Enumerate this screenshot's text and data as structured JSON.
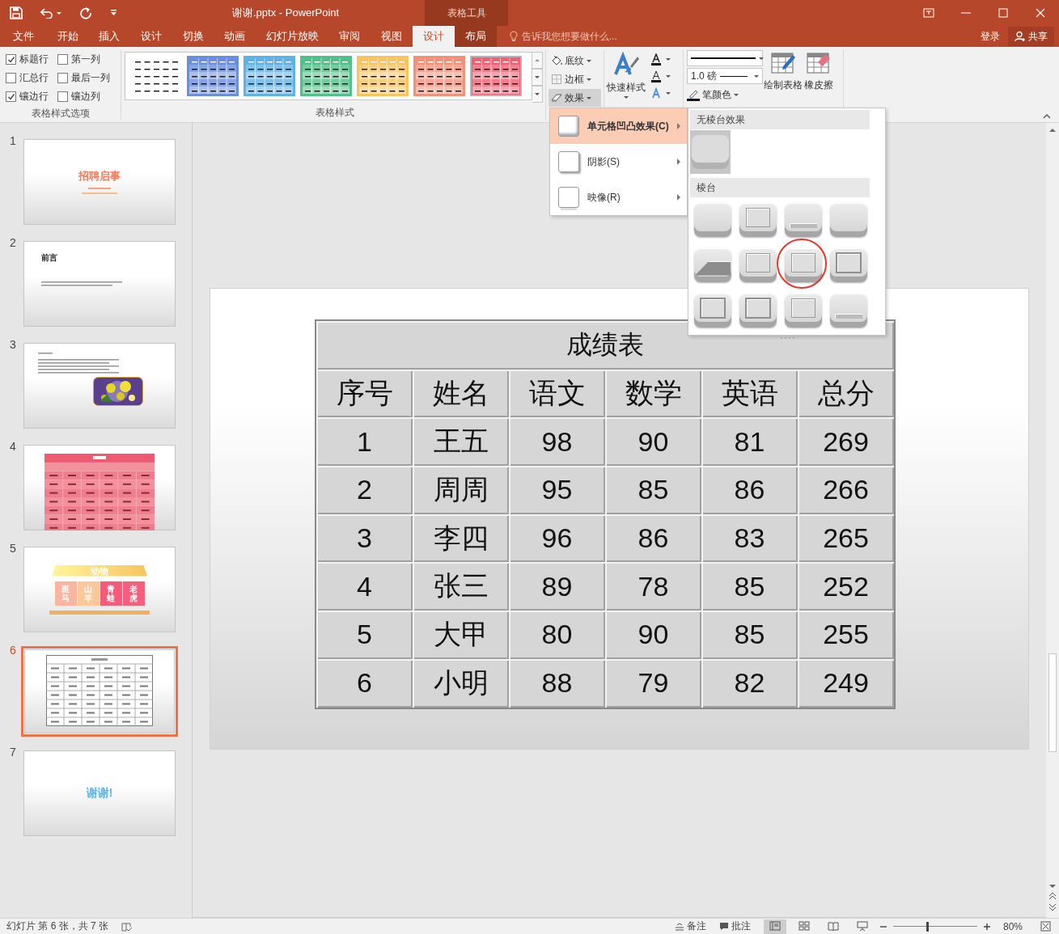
{
  "title_bar": {
    "title": "谢谢.pptx - PowerPoint",
    "context_label": "表格工具"
  },
  "tabs": [
    {
      "label": "文件",
      "selected": false,
      "context": false
    },
    {
      "label": "开始",
      "selected": false,
      "context": false
    },
    {
      "label": "插入",
      "selected": false,
      "context": false
    },
    {
      "label": "设计",
      "selected": false,
      "context": false
    },
    {
      "label": "切换",
      "selected": false,
      "context": false
    },
    {
      "label": "动画",
      "selected": false,
      "context": false
    },
    {
      "label": "幻灯片放映",
      "selected": false,
      "context": false
    },
    {
      "label": "审阅",
      "selected": false,
      "context": false
    },
    {
      "label": "视图",
      "selected": false,
      "context": false
    },
    {
      "label": "设计",
      "selected": true,
      "context": true
    },
    {
      "label": "布局",
      "selected": false,
      "context": true
    }
  ],
  "tell_me": {
    "text": "告诉我您想要做什么..."
  },
  "account": {
    "sign_in": "登录",
    "share": "共享"
  },
  "style_options": {
    "label": "表格样式选项",
    "options": [
      {
        "label": "标题行",
        "checked": true
      },
      {
        "label": "第一列",
        "checked": false
      },
      {
        "label": "汇总行",
        "checked": false
      },
      {
        "label": "最后一列",
        "checked": false
      },
      {
        "label": "镶边行",
        "checked": true
      },
      {
        "label": "镶边列",
        "checked": false
      }
    ]
  },
  "table_styles": {
    "label": "表格样式",
    "swatches": [
      {
        "color": "#ffffff",
        "selected": false
      },
      {
        "color": "#6b8fdc",
        "selected": false
      },
      {
        "color": "#5eb2e6",
        "selected": false
      },
      {
        "color": "#52c08a",
        "selected": false
      },
      {
        "color": "#f8c460",
        "selected": false
      },
      {
        "color": "#f2917a",
        "selected": false
      },
      {
        "color": "#ef6075",
        "selected": true
      }
    ]
  },
  "format_buttons": [
    {
      "label": "底纹",
      "kind": "shading",
      "pressed": false
    },
    {
      "label": "边框",
      "kind": "borders",
      "pressed": false
    },
    {
      "label": "效果",
      "kind": "effects",
      "pressed": true
    }
  ],
  "wordart": {
    "quick_styles": "快速样式"
  },
  "borders": {
    "pen_weight": "1.0 磅",
    "pen_color": "笔颜色",
    "tools": [
      {
        "label": "绘制表格",
        "kind": "draw"
      },
      {
        "label": "橡皮擦",
        "kind": "eraser"
      }
    ]
  },
  "effects_menu": [
    {
      "label": "单元格凹凸效果(C)",
      "selected": true,
      "kind": "bevel"
    },
    {
      "label": "阴影(S)",
      "selected": false,
      "kind": "shadow"
    },
    {
      "label": "映像(R)",
      "selected": false,
      "kind": "reflection"
    }
  ],
  "bevel_gallery": [
    {
      "title": "无棱台效果",
      "items": [
        {
          "selected": true,
          "circled": false
        }
      ]
    },
    {
      "title": "棱台",
      "items": [
        {
          "selected": false,
          "circled": false
        },
        {
          "selected": false,
          "circled": false
        },
        {
          "selected": false,
          "circled": false
        },
        {
          "selected": false,
          "circled": false
        },
        {
          "selected": false,
          "circled": false
        },
        {
          "selected": false,
          "circled": false
        },
        {
          "selected": false,
          "circled": true
        },
        {
          "selected": false,
          "circled": false
        },
        {
          "selected": false,
          "circled": false
        },
        {
          "selected": false,
          "circled": false
        },
        {
          "selected": false,
          "circled": false
        },
        {
          "selected": false,
          "circled": false
        }
      ]
    }
  ],
  "slides": [
    {
      "number": "1",
      "selected": false,
      "kind": "cover",
      "title": "招聘启事",
      "color": "#f07a5a"
    },
    {
      "number": "2",
      "selected": false,
      "kind": "heading",
      "title": "前言",
      "color": "#222222"
    },
    {
      "number": "3",
      "selected": false
    },
    {
      "number": "4",
      "selected": false,
      "kind": "pinktable"
    },
    {
      "number": "5",
      "selected": false,
      "kind": "tiles",
      "title": "动物",
      "tiles": [
        {
          "text": "斑马",
          "color": "#fbb49f"
        },
        {
          "text": "山羊",
          "color": "#fcc89a"
        },
        {
          "text": "青蛙",
          "color": "#f65a78"
        },
        {
          "text": "老虎",
          "color": "#f4607c"
        }
      ]
    },
    {
      "number": "6",
      "selected": true,
      "kind": "table"
    },
    {
      "number": "7",
      "selected": false,
      "kind": "closing",
      "title": "谢谢!",
      "color": "#5fb6ea"
    }
  ],
  "table": {
    "title": "成绩表",
    "columns": [
      "序号",
      "姓名",
      "语文",
      "数学",
      "英语",
      "总分"
    ],
    "rows": [
      [
        "1",
        "王五",
        "98",
        "90",
        "81",
        "269"
      ],
      [
        "2",
        "周周",
        "95",
        "85",
        "86",
        "266"
      ],
      [
        "3",
        "李四",
        "96",
        "86",
        "83",
        "265"
      ],
      [
        "4",
        "张三",
        "89",
        "78",
        "85",
        "252"
      ],
      [
        "5",
        "大甲",
        "80",
        "90",
        "85",
        "255"
      ],
      [
        "6",
        "小明",
        "88",
        "79",
        "82",
        "249"
      ]
    ]
  },
  "status_bar": {
    "slide_info": "幻灯片 第 6 张，共 7 张",
    "notes": "备注",
    "comments": "批注",
    "views": [
      {
        "kind": "normal",
        "selected": true
      },
      {
        "kind": "sorter",
        "selected": false
      },
      {
        "kind": "reading",
        "selected": false
      },
      {
        "kind": "slideshow",
        "selected": false
      }
    ],
    "zoom": {
      "level": 0.4,
      "reading": "80%"
    }
  }
}
